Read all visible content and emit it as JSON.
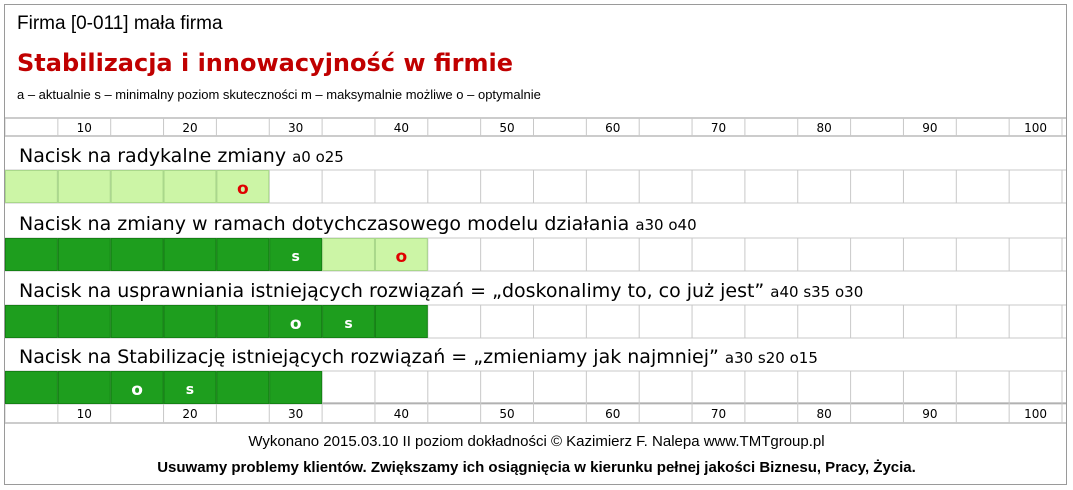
{
  "header": {
    "firm": "Firma [0-011] mała firma",
    "title": "Stabilizacja i innowacyjność  w firmie",
    "legend": "a – aktualnie   s – minimalny poziom skuteczności   m – maksymalnie możliwe   o – optymalnie"
  },
  "footer": {
    "line1": "Wykonano 2015.03.10   II poziom dokładności    © Kazimierz F. Nalepa    www.TMTgroup.pl",
    "line2": "Usuwamy problemy klientów. Zwiększamy ich osiągnięcia w kierunku pełnej jakości Biznesu, Pracy, Życia."
  },
  "chart_data": {
    "type": "bar",
    "xlim": [
      0,
      100
    ],
    "step": 5,
    "ticks": [
      10,
      20,
      30,
      40,
      50,
      60,
      70,
      80,
      90,
      100
    ],
    "colors": {
      "bar_dark": "#1e9e1e",
      "bar_light": "#ccf5a6",
      "marker_red": "#e00000",
      "marker_white": "#ffffff",
      "grid": "#c8c8c8"
    },
    "rows": [
      {
        "label": "Nacisk na radykalne zmiany",
        "values_label": "a0   o25",
        "a": 0,
        "s": null,
        "o": 25
      },
      {
        "label": "Nacisk na zmiany w ramach dotychczasowego modelu działania",
        "values_label": "a30  o40",
        "a": 30,
        "s": 30,
        "o": 40
      },
      {
        "label": "Nacisk na usprawniania istniejących rozwiązań = „doskonalimy to, co już jest”",
        "values_label": "a40 s35 o30",
        "a": 40,
        "s": 35,
        "o": 30
      },
      {
        "label": "Nacisk na Stabilizację istniejących rozwiązań = „zmieniamy jak najmniej”",
        "values_label": "a30 s20 o15",
        "a": 30,
        "s": 20,
        "o": 15
      }
    ]
  }
}
